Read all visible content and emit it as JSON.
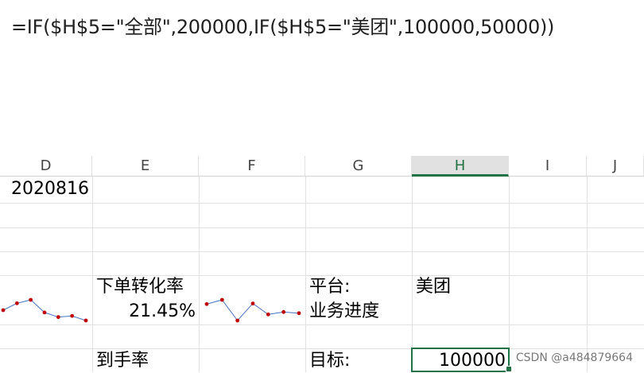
{
  "formula_bar": {
    "text": "=IF($H$5=\"全部\",200000,IF($H$5=\"美团\",100000,50000))"
  },
  "columns": [
    "D",
    "E",
    "F",
    "G",
    "H",
    "I",
    "J"
  ],
  "active_column": "H",
  "cells": {
    "d1": "2020816",
    "e5": "下单转化率",
    "e6": "21.45%",
    "g5": "平台:",
    "h5": "美团",
    "g6": "业务进度",
    "e8": "到手率",
    "g8": "目标:",
    "h8": "100000"
  },
  "sparklines": {
    "line_color": "#4472c4",
    "marker_color": "#c00000",
    "d_series": [
      6.0,
      7.2,
      7.8,
      5.6,
      4.8,
      5.0,
      4.2
    ],
    "f_series": [
      7.5,
      8.2,
      4.8,
      7.6,
      5.8,
      6.2,
      6.0
    ]
  },
  "watermark": "CSDN @a484879664"
}
